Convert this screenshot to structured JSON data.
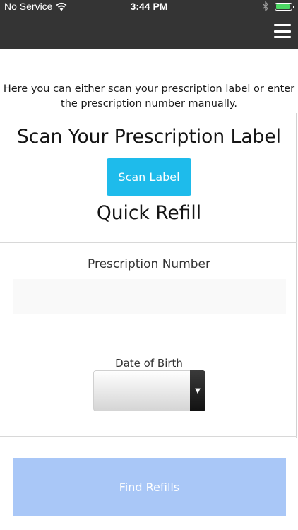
{
  "status_bar": {
    "carrier": "No Service",
    "time": "3:44 PM",
    "battery_level": 0.9,
    "battery_color": "#4cd964"
  },
  "header": {
    "background": "#343434",
    "menu_icon": "hamburger-menu-icon"
  },
  "intro": {
    "line1": "Here you can either scan your prescription label or enter",
    "line2": "the prescription number manually."
  },
  "scan": {
    "title": "Scan Your Prescription Label",
    "button_label": "Scan Label",
    "button_color": "#1ebbeb"
  },
  "quick_refill": {
    "title": "Quick Refill",
    "prescription_label": "Prescription Number",
    "prescription_value": "",
    "dob_label": "Date of Birth",
    "dob_value": ""
  },
  "find_button": {
    "label": "Find Refills",
    "color": "#a9c7f7"
  }
}
